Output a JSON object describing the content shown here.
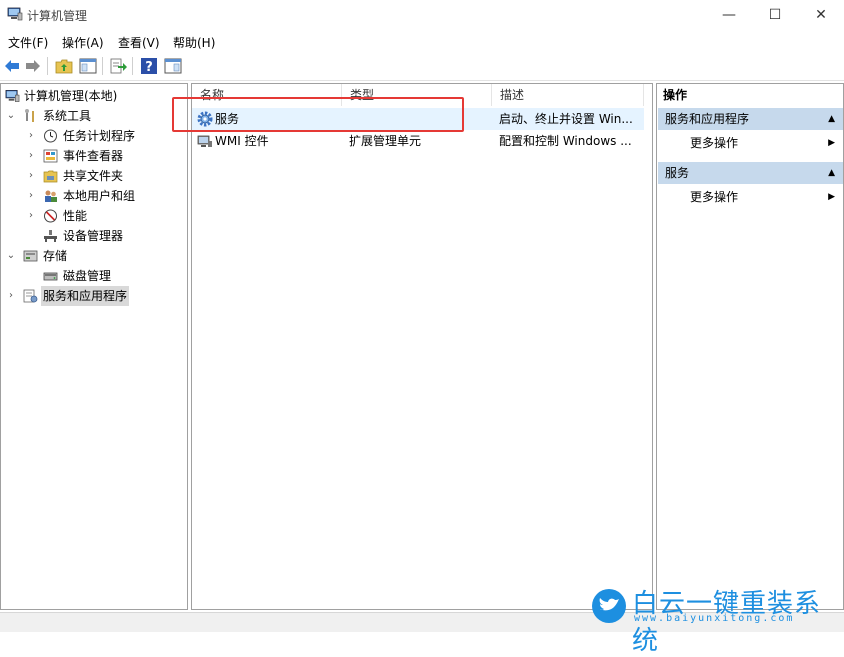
{
  "window": {
    "title": "计算机管理",
    "controls": {
      "minimize": "—",
      "maximize": "☐",
      "close": "✕"
    }
  },
  "menu": [
    "文件(F)",
    "操作(A)",
    "查看(V)",
    "帮助(H)"
  ],
  "tree": {
    "root": "计算机管理(本地)",
    "system_tools": "系统工具",
    "task_scheduler": "任务计划程序",
    "event_viewer": "事件查看器",
    "shared_folders": "共享文件夹",
    "local_users": "本地用户和组",
    "performance": "性能",
    "device_manager": "设备管理器",
    "storage": "存储",
    "disk_management": "磁盘管理",
    "services_apps": "服务和应用程序"
  },
  "list": {
    "headers": {
      "name": "名称",
      "type": "类型",
      "description": "描述"
    },
    "rows": [
      {
        "name": "服务",
        "type": "",
        "description": "启动、终止并设置 Win..."
      },
      {
        "name": "WMI 控件",
        "type": "扩展管理单元",
        "description": "配置和控制 Windows ..."
      }
    ]
  },
  "actions": {
    "header": "操作",
    "section1": "服务和应用程序",
    "section1_more": "更多操作",
    "section2": "服务",
    "section2_more": "更多操作"
  },
  "watermark": {
    "title": "白云一键重装系统",
    "url": "www.baiyunxitong.com"
  },
  "colors": {
    "section_bg": "#c6d9ec",
    "highlight": "#e53935",
    "watermark": "#1d8fe0"
  }
}
